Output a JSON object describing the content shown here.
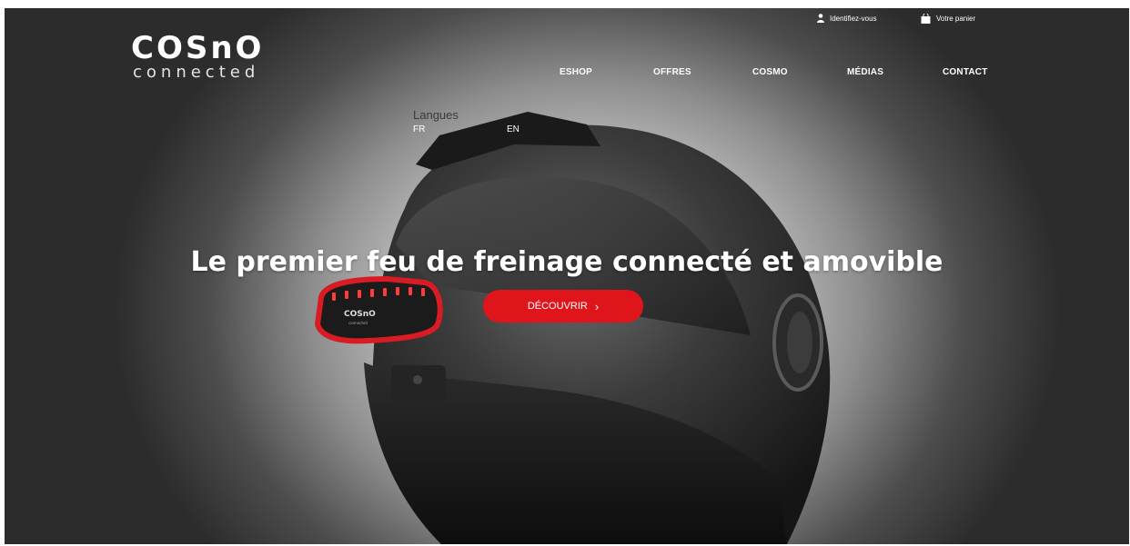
{
  "brand": {
    "logo_top": "COSnO",
    "logo_bottom": "connected",
    "device_logo": "COSnO",
    "device_logo_sub": "connected"
  },
  "header": {
    "login_label": "Identifiez-vous",
    "cart_label": "Votre panier",
    "nav": [
      "ESHOP",
      "OFFRES",
      "COSMO",
      "MÉDIAS",
      "CONTACT"
    ]
  },
  "language": {
    "label": "Langues",
    "options": [
      "FR",
      "EN"
    ]
  },
  "hero": {
    "title": "Le premier feu de freinage connecté et amovible",
    "cta_label": "DÉCOUVRIR",
    "cta_arrow": "›"
  },
  "icons": {
    "login": "user-icon",
    "cart": "shopping-bag-icon"
  },
  "colors": {
    "accent": "#e0151c",
    "text": "#ffffff"
  }
}
